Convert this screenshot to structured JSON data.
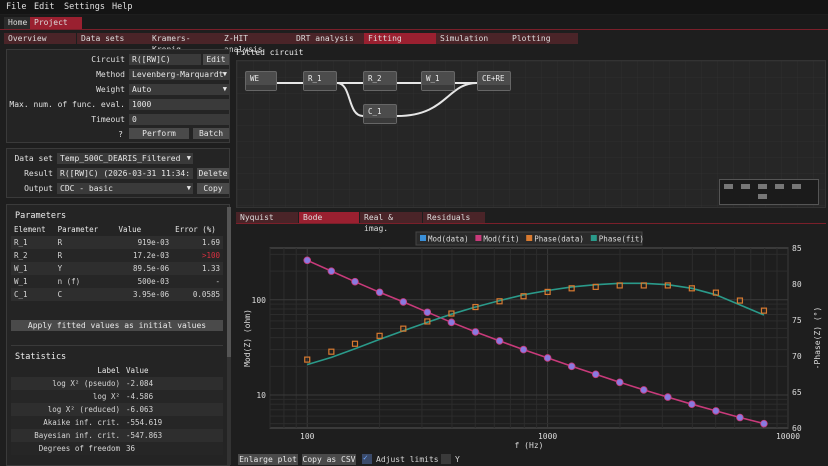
{
  "menu": {
    "file": "File",
    "edit": "Edit",
    "settings": "Settings",
    "help": "Help"
  },
  "windows": {
    "home": "Home",
    "project": "Project"
  },
  "tabs": [
    "Overview",
    "Data sets",
    "Kramers-Kronig",
    "Z-HIT analysis",
    "DRT analysis",
    "Fitting",
    "Simulation",
    "Plotting"
  ],
  "fit_settings": {
    "circuit_label": "Circuit",
    "circuit_value": "R([RW]C)",
    "edit": "Edit",
    "method_label": "Method",
    "method_value": "Levenberg-Marquardt",
    "weight_label": "Weight",
    "weight_value": "Auto",
    "maxeval_label": "Max. num. of func. eval.",
    "maxeval_value": "1000",
    "timeout_label": "Timeout",
    "timeout_value": "0",
    "help": "?",
    "perform": "Perform",
    "batch": "Batch"
  },
  "dataset": {
    "dataset_label": "Data set",
    "dataset_value": "Temp_500C_DEARIS_Filtered",
    "result_label": "Result",
    "result_value": "R([RW]C) (2026-03-31 11:34:",
    "delete": "Delete",
    "output_label": "Output",
    "output_value": "CDC - basic",
    "copy": "Copy"
  },
  "parameters": {
    "title": "Parameters",
    "headers": [
      "Element",
      "Parameter",
      "Value",
      "Error (%)"
    ],
    "rows": [
      [
        "R_1",
        "R",
        "919e-03",
        "1.69"
      ],
      [
        "R_2",
        "R",
        "17.2e-03",
        ">100"
      ],
      [
        "W_1",
        "Y",
        "89.5e-06",
        "1.33"
      ],
      [
        "W_1",
        "n (f)",
        "500e-03",
        "-"
      ],
      [
        "C_1",
        "C",
        "3.95e-06",
        "0.0585"
      ]
    ],
    "apply": "Apply fitted values as initial values"
  },
  "statistics": {
    "title": "Statistics",
    "headers": [
      "Label",
      "Value"
    ],
    "rows": [
      [
        "log X² (pseudo)",
        "-2.084"
      ],
      [
        "log X²",
        "-4.586"
      ],
      [
        "log X² (reduced)",
        "-6.063"
      ],
      [
        "Akaike inf. crit.",
        "-554.619"
      ],
      [
        "Bayesian inf. crit.",
        "-547.863"
      ],
      [
        "Degrees of freedom",
        "36"
      ]
    ]
  },
  "circuit": {
    "title": "Fitted circuit",
    "nodes": [
      "WE",
      "R_1",
      "R_2",
      "W_1",
      "CE+RE",
      "C_1"
    ]
  },
  "plot_tabs": [
    "Nyquist",
    "Bode",
    "Real & imag.",
    "Residuals"
  ],
  "plot_buttons": {
    "enlarge": "Enlarge plot",
    "copy_csv": "Copy as CSV",
    "adjust": "Adjust limits",
    "y": "Y"
  },
  "colors": {
    "mod_data": "#3a8fd8",
    "mod_fit": "#c83a7a",
    "phase_data": "#d87a30",
    "phase_fit": "#2a9a8a",
    "accent": "#9a2030"
  },
  "chart_data": {
    "type": "line",
    "legend": [
      "Mod(data)",
      "Mod(fit)",
      "Phase(data)",
      "Phase(fit)"
    ],
    "legend_position": "top",
    "xlabel": "f (Hz)",
    "ylabel": "Mod(Z) (ohm)",
    "ylabel_right": "-Phase(Z) (°)",
    "xscale": "log",
    "yscale": "log",
    "xlim": [
      70,
      10000
    ],
    "ylim": [
      4.5,
      350
    ],
    "ylim_right": [
      60,
      85
    ],
    "x_ticks": [
      "100",
      "1000",
      "10000"
    ],
    "y_ticks": [
      "10",
      "100"
    ],
    "y_right_ticks": [
      "60",
      "65",
      "70",
      "75",
      "80",
      "85"
    ],
    "grid": true,
    "x": [
      100,
      126,
      158,
      200,
      251,
      316,
      398,
      501,
      631,
      794,
      1000,
      1259,
      1585,
      1995,
      2512,
      3162,
      3981,
      5012,
      6310,
      7943
    ],
    "series": [
      {
        "name": "Mod(data)",
        "axis": "left",
        "values": [
          260,
          200,
          155,
          120,
          95,
          74,
          58,
          46,
          37,
          30,
          24.5,
          20,
          16.5,
          13.6,
          11.3,
          9.5,
          8.0,
          6.8,
          5.8,
          5.0
        ]
      },
      {
        "name": "Mod(fit)",
        "axis": "left",
        "values": [
          260,
          200,
          155,
          120,
          95,
          74,
          58,
          46,
          37,
          30,
          24.5,
          20,
          16.5,
          13.6,
          11.3,
          9.5,
          8.0,
          6.8,
          5.8,
          5.0
        ]
      },
      {
        "name": "Phase(data)",
        "axis": "right",
        "values": [
          69.5,
          70.6,
          71.7,
          72.8,
          73.8,
          74.8,
          75.9,
          76.8,
          77.6,
          78.3,
          78.9,
          79.4,
          79.6,
          79.8,
          79.8,
          79.8,
          79.4,
          78.8,
          77.7,
          76.3
        ]
      },
      {
        "name": "Phase(fit)",
        "axis": "right",
        "values": [
          68.8,
          69.8,
          71.0,
          72.3,
          73.5,
          74.7,
          75.8,
          76.8,
          77.7,
          78.5,
          79.1,
          79.6,
          79.9,
          80.1,
          80.1,
          79.9,
          79.4,
          78.5,
          77.1,
          75.7
        ]
      }
    ]
  }
}
